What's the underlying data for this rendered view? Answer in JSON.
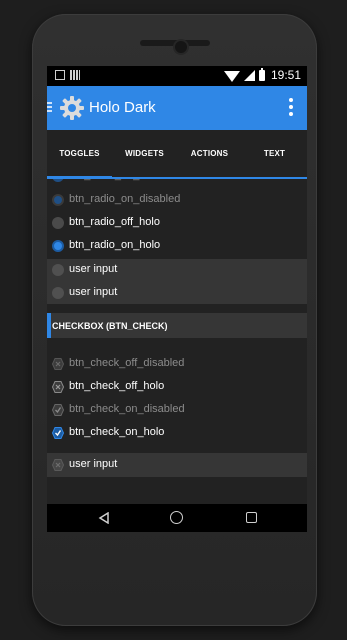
{
  "status_bar": {
    "time": "19:51"
  },
  "app_bar": {
    "title": "Holo Dark",
    "gear_icon": "gear-icon",
    "overflow_icon": "overflow-menu-icon",
    "accent": "#2f87e6"
  },
  "tabs": [
    {
      "label": "TOGGLES"
    },
    {
      "label": "WIDGETS"
    },
    {
      "label": "ACTIONS"
    },
    {
      "label": "TEXT"
    }
  ],
  "radio_section": {
    "items": [
      {
        "label": "btn_radio_on_disabled"
      },
      {
        "label": "btn_radio_on_disabled"
      },
      {
        "label": "btn_radio_off_holo"
      },
      {
        "label": "btn_radio_on_holo"
      },
      {
        "label": "user input"
      },
      {
        "label": "user input"
      }
    ]
  },
  "checkbox_section": {
    "header": "CHECKBOX (BTN_CHECK)",
    "items": [
      {
        "label": "btn_check_off_disabled"
      },
      {
        "label": "btn_check_off_holo"
      },
      {
        "label": "btn_check_on_disabled"
      },
      {
        "label": "btn_check_on_holo"
      },
      {
        "label": "user input"
      }
    ]
  },
  "nav_bar": {
    "back": "back-icon",
    "home": "home-icon",
    "recents": "recents-icon"
  }
}
